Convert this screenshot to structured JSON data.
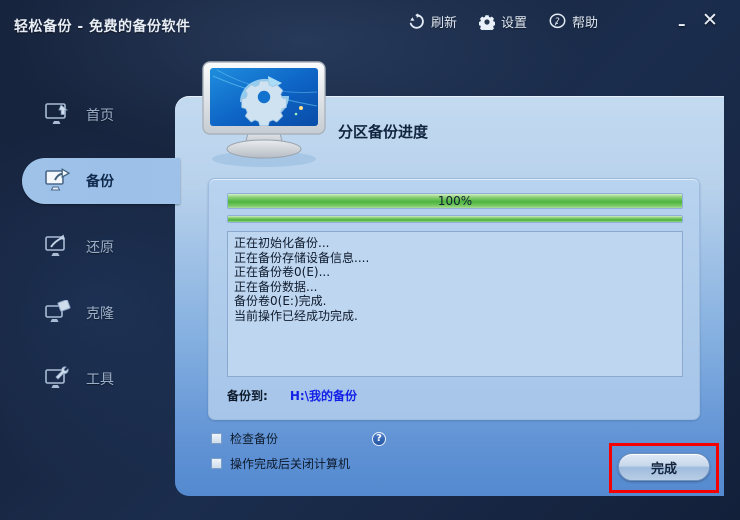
{
  "window": {
    "title": "轻松备份 - 免费的备份软件",
    "minimize_label": "–",
    "close_label": "✕"
  },
  "toolbar": {
    "refresh_label": "刷新",
    "settings_label": "设置",
    "help_label": "帮助"
  },
  "sidebar": {
    "items": [
      {
        "label": "首页",
        "icon": "monitor-home-icon",
        "active": false
      },
      {
        "label": "备份",
        "icon": "monitor-backup-icon",
        "active": true
      },
      {
        "label": "还原",
        "icon": "monitor-restore-icon",
        "active": false
      },
      {
        "label": "克隆",
        "icon": "monitor-clone-icon",
        "active": false
      },
      {
        "label": "工具",
        "icon": "monitor-tools-icon",
        "active": false
      }
    ]
  },
  "main": {
    "heading": "分区备份进度",
    "hero_icon": "monitor-gear-sync-icon",
    "progress": {
      "percent_label": "100%",
      "percent_value": 100,
      "sub_percent_value": 100
    },
    "log_lines": [
      "正在初始化备份...",
      "正在备份存储设备信息....",
      "正在备份卷0(E)...",
      "正在备份数据...",
      "备份卷0(E:)完成.",
      "当前操作已经成功完成."
    ],
    "destination": {
      "label": "备份到:",
      "path": "H:\\我的备份"
    },
    "options": [
      {
        "label": "检查备份",
        "checked": false,
        "has_help": true
      },
      {
        "label": "操作完成后关闭计算机",
        "checked": false,
        "has_help": false
      }
    ],
    "help_glyph": "?",
    "finish_button": "完成"
  },
  "colors": {
    "accent_green": "#4cb43e",
    "panel_blue": "#b9d2ec",
    "path_blue": "#1220e8",
    "annotation_red": "#f40000"
  }
}
